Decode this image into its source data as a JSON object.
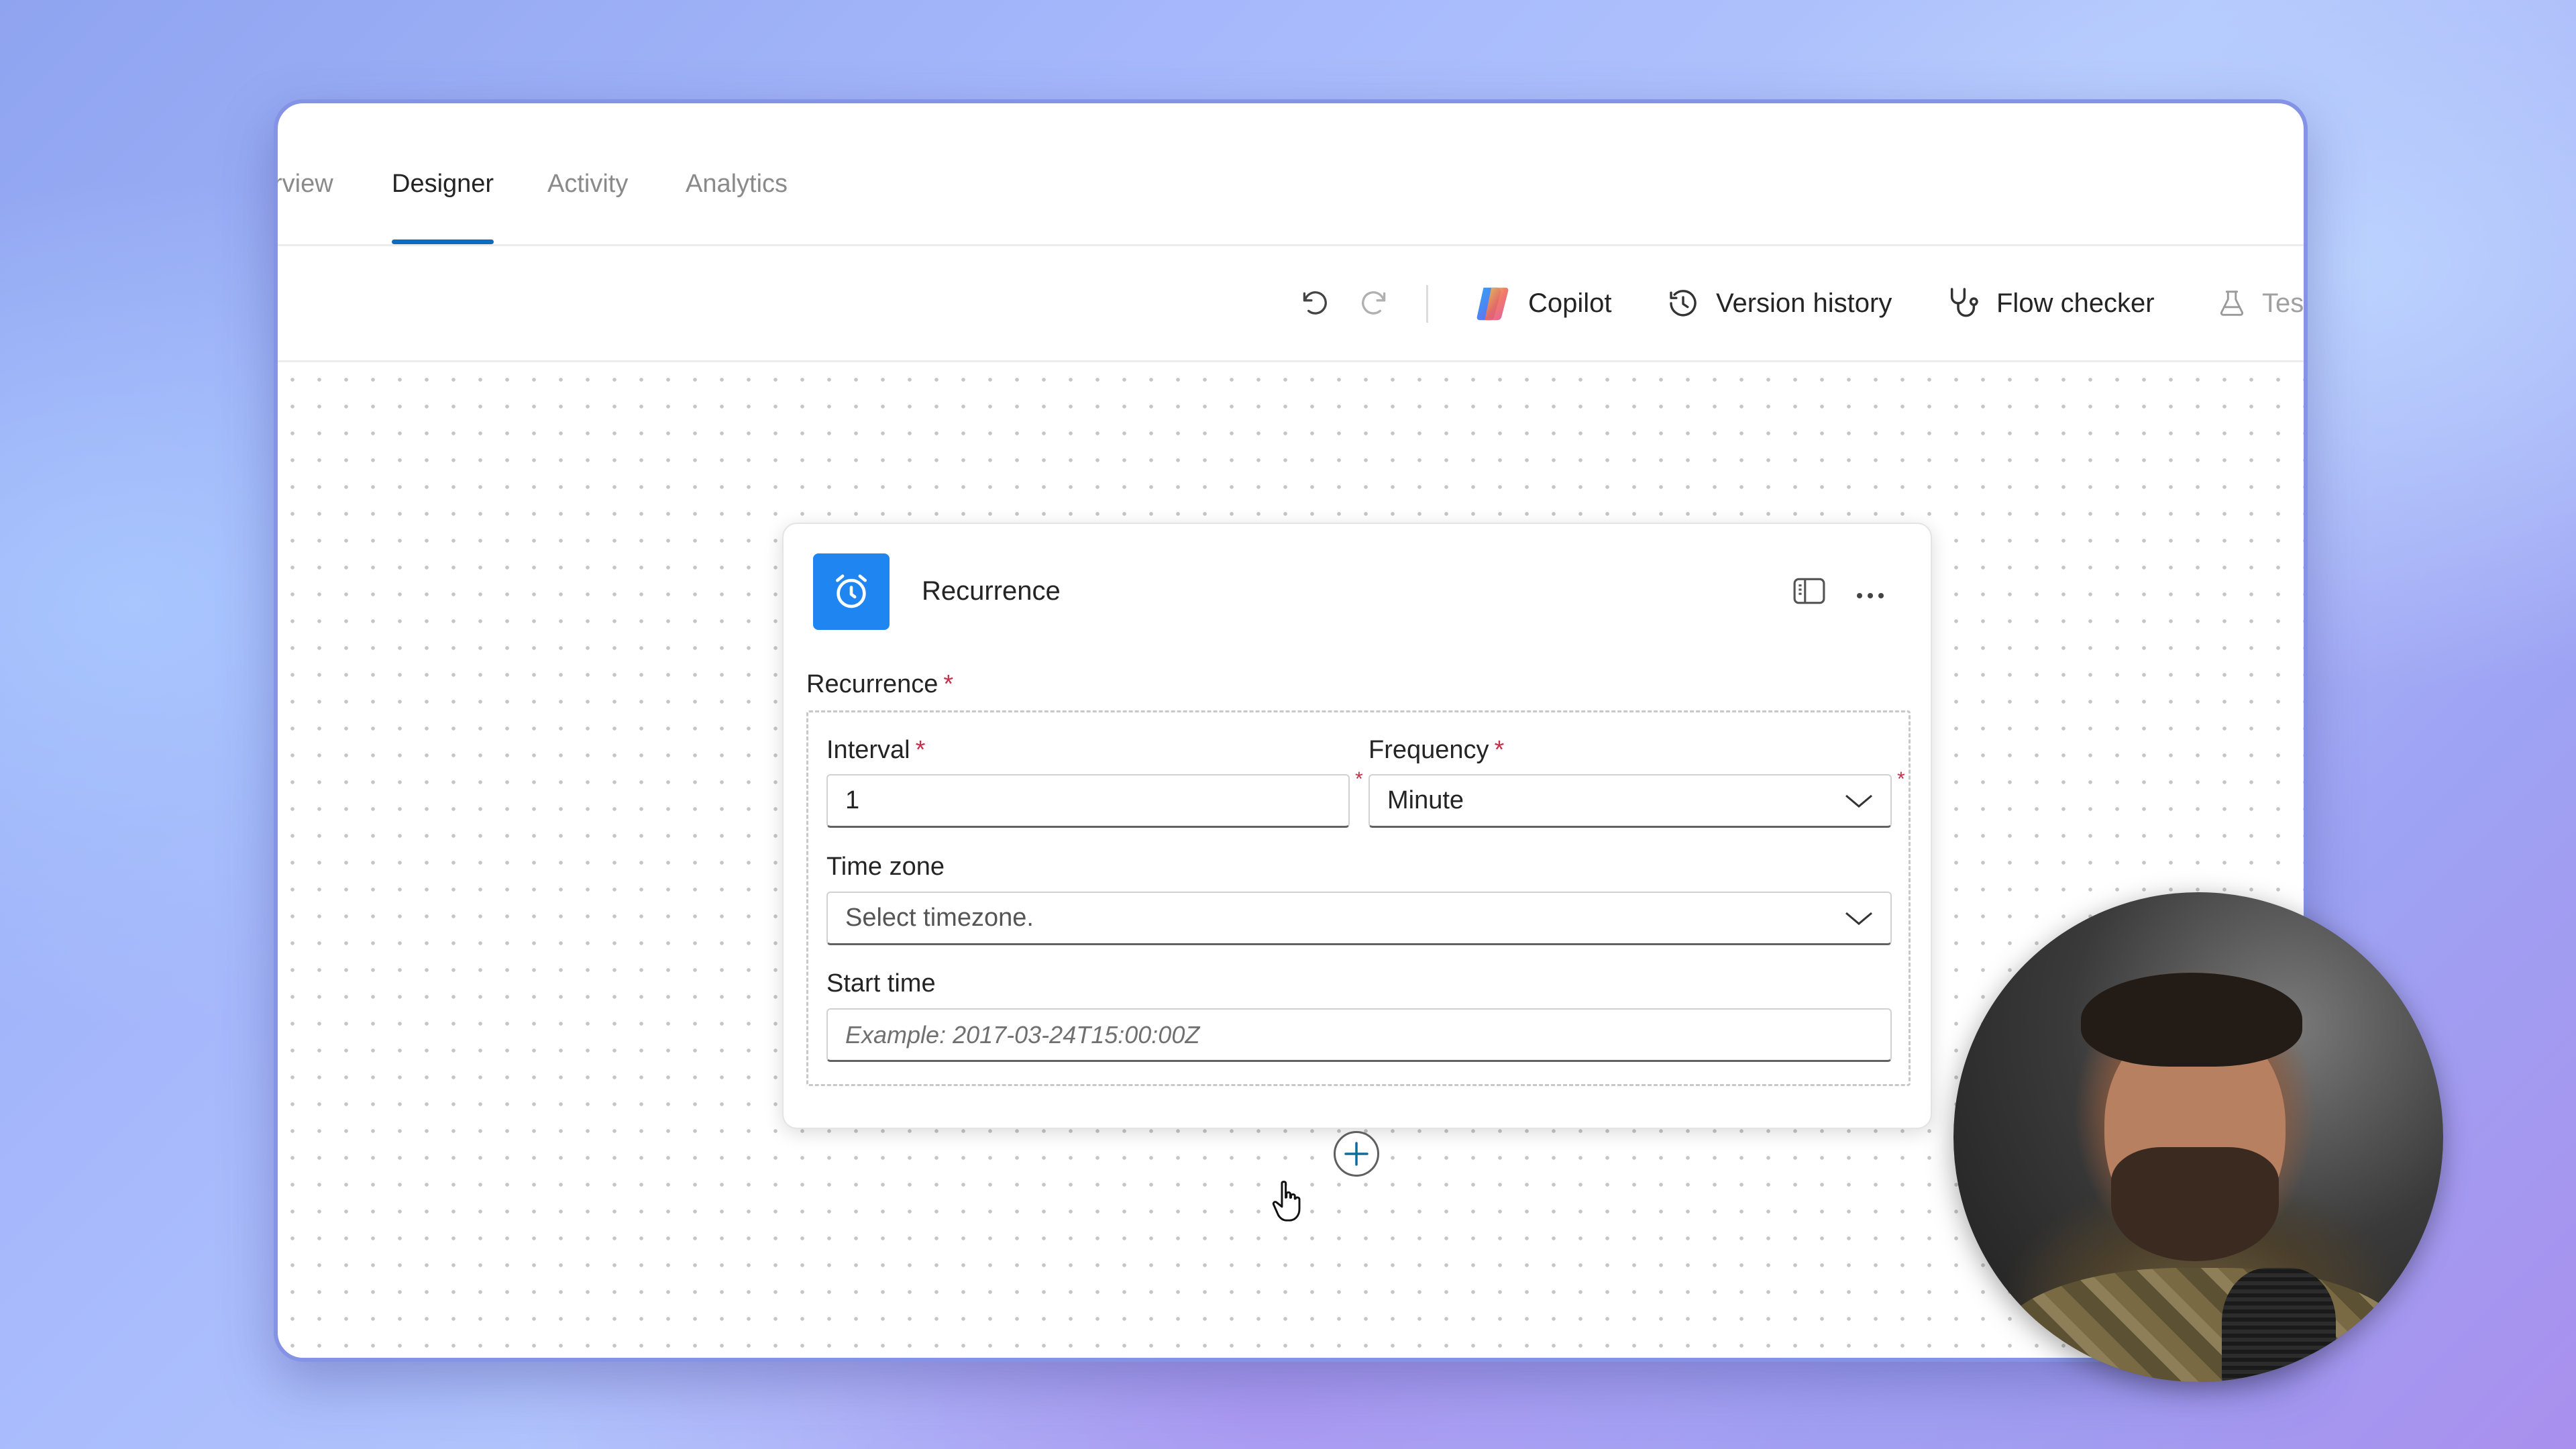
{
  "tabs": [
    {
      "label": "rview",
      "active": false
    },
    {
      "label": "Designer",
      "active": true
    },
    {
      "label": "Activity",
      "active": false
    },
    {
      "label": "Analytics",
      "active": false
    }
  ],
  "toolbar": {
    "undo_icon": "undo-icon",
    "redo_icon": "redo-icon",
    "copilot_label": "Copilot",
    "version_history_label": "Version history",
    "flow_checker_label": "Flow checker",
    "test_label": "Tes"
  },
  "card": {
    "title": "Recurrence",
    "icon": "alarm-clock-icon",
    "accent_color": "#1f85f0",
    "section_label": "Recurrence",
    "required_mark": "*",
    "interval": {
      "label": "Interval",
      "value": "1"
    },
    "frequency": {
      "label": "Frequency",
      "value": "Minute"
    },
    "time_zone": {
      "label": "Time zone",
      "placeholder": "Select timezone."
    },
    "start_time": {
      "label": "Start time",
      "placeholder": "Example: 2017-03-24T15:00:00Z"
    }
  },
  "colors": {
    "tab_underline": "#0f6cbd",
    "required": "#c4314b"
  }
}
